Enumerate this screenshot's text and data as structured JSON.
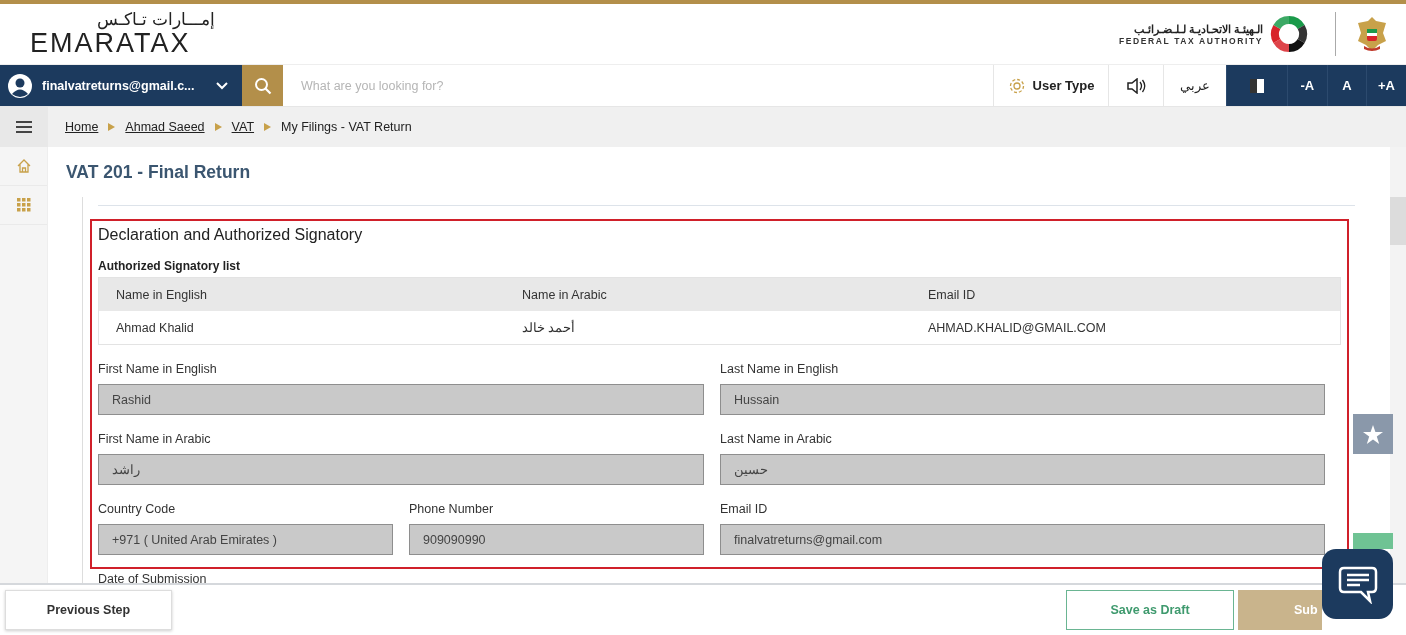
{
  "header": {
    "logo_arabic": "إمـــارات تـاكـس",
    "logo_text": "EMARATAX",
    "authority_arabic": "الـهيئـة الاتحـاديـة لـلـضـرائـب",
    "authority_english": "FEDERAL TAX AUTHORITY"
  },
  "navbar": {
    "user": "finalvatreturns@gmail.c...",
    "search": {
      "placeholder": "What are you looking for?"
    },
    "user_type": "User Type",
    "language": "عربي",
    "font_sizes": [
      "-A",
      "A",
      "+A"
    ]
  },
  "breadcrumb": [
    {
      "label": "Home",
      "link": true
    },
    {
      "label": "Ahmad Saeed",
      "link": true
    },
    {
      "label": "VAT",
      "link": true
    },
    {
      "label": "My Filings - VAT Return",
      "link": false
    }
  ],
  "page_title": "VAT 201 - Final Return",
  "section": {
    "title": "Declaration and Authorized Signatory",
    "list_title": "Authorized Signatory list",
    "table": {
      "columns": [
        "Name in English",
        "Name in Arabic",
        "Email ID"
      ],
      "rows": [
        [
          "Ahmad Khalid",
          "أحمد خالد",
          "AHMAD.KHALID@GMAIL.COM"
        ]
      ]
    },
    "field_rows": [
      {
        "left": [
          {
            "label": "First Name in English",
            "value": "Rashid"
          }
        ],
        "right": {
          "label": "Last Name in English",
          "value": "Hussain"
        }
      },
      {
        "left": [
          {
            "label": "First Name in Arabic",
            "value": "راشد"
          }
        ],
        "right": {
          "label": "Last Name in Arabic",
          "value": "حسين"
        }
      },
      {
        "left": [
          {
            "label": "Country Code",
            "value": "+971 ( United Arab Emirates )"
          },
          {
            "label": "Phone Number",
            "value": "909090990"
          }
        ],
        "right": {
          "label": "Email ID",
          "value": "finalvatreturns@gmail.com"
        }
      }
    ],
    "next_label": "Date of Submission"
  },
  "footer": {
    "previous": "Previous Step",
    "draft": "Save as Draft",
    "submit": "Sub"
  }
}
